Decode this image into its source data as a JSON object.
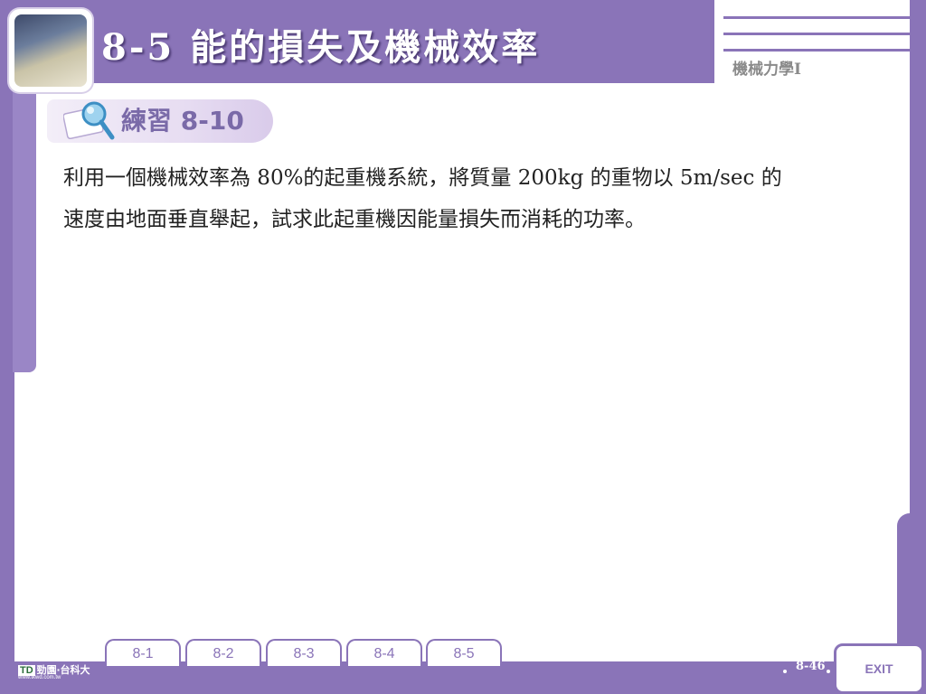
{
  "header": {
    "title": "8-5 能的損失及機械效率",
    "subject": "機械力學I"
  },
  "practice": {
    "label": "練習 8-10"
  },
  "problem": {
    "line1": "利用一個機械效率為 80%的起重機系統，將質量 200kg 的重物以 5m/sec 的",
    "line2": "速度由地面垂直舉起，試求此起重機因能量損失而消耗的功率。"
  },
  "nav": {
    "tabs": [
      {
        "label": "8-1"
      },
      {
        "label": "8-2"
      },
      {
        "label": "8-3"
      },
      {
        "label": "8-4"
      },
      {
        "label": "8-5"
      }
    ]
  },
  "footer": {
    "page_number": "8-46",
    "exit_label": "EXIT",
    "logo_text": "勁園‧台科大",
    "logo_mark": "TD",
    "logo_url": "www.tkwd.com.tw"
  },
  "colors": {
    "frame": "#8a74b8",
    "practice_label": "#7a6aa8"
  }
}
